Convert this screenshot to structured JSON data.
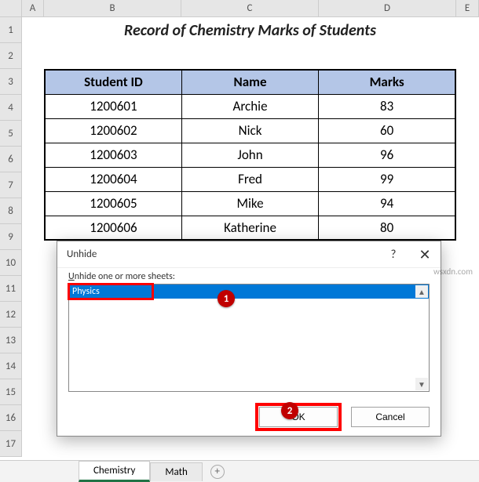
{
  "columns": [
    "A",
    "B",
    "C",
    "D",
    "E"
  ],
  "rows": [
    "1",
    "2",
    "3",
    "4",
    "5",
    "6",
    "7",
    "8",
    "9",
    "10",
    "11",
    "12",
    "13",
    "14",
    "15",
    "16",
    "17"
  ],
  "title": "Record of Chemistry Marks of Students",
  "headers": {
    "b": "Student ID",
    "c": "Name",
    "d": "Marks"
  },
  "data": [
    {
      "id": "1200601",
      "name": "Archie",
      "marks": "83"
    },
    {
      "id": "1200602",
      "name": "Nick",
      "marks": "60"
    },
    {
      "id": "1200603",
      "name": "John",
      "marks": "96"
    },
    {
      "id": "1200604",
      "name": "Fred",
      "marks": "99"
    },
    {
      "id": "1200605",
      "name": "Mike",
      "marks": "94"
    },
    {
      "id": "1200606",
      "name": "Katherine",
      "marks": "80"
    }
  ],
  "dialog": {
    "title": "Unhide",
    "label_pre": "U",
    "label_post": "nhide one or more sheets:",
    "item": "Physics",
    "ok": "OK",
    "cancel": "Cancel",
    "help": "?",
    "close": "✕"
  },
  "tabs": {
    "active": "Chemistry",
    "other": "Math",
    "plus": "+"
  },
  "markers": {
    "m1": "1",
    "m2": "2"
  },
  "watermark": "wsxdn.com"
}
